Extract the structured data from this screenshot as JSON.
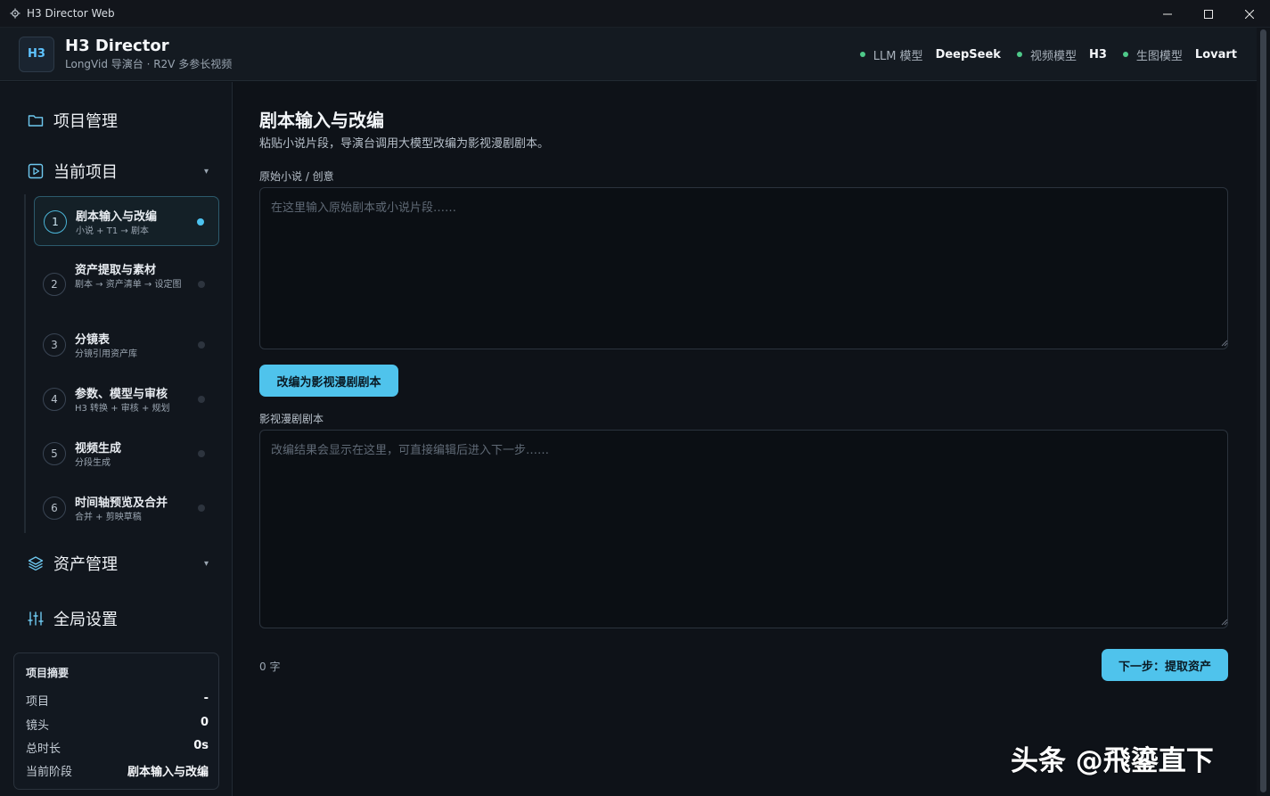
{
  "window": {
    "title": "H3 Director Web"
  },
  "header": {
    "logo": "H3",
    "title": "H3 Director",
    "subtitle": "LongVid 导演台 · R2V 多参长视频",
    "models": [
      {
        "label": "LLM 模型",
        "value": "DeepSeek"
      },
      {
        "label": "视频模型",
        "value": "H3"
      },
      {
        "label": "生图模型",
        "value": "Lovart"
      }
    ],
    "status_color": "#4ec989"
  },
  "sidebar": {
    "project_management": "项目管理",
    "current_project": "当前项目",
    "steps": [
      {
        "num": "1",
        "title": "剧本输入与改编",
        "desc": "小说 + T1 → 剧本",
        "active": true
      },
      {
        "num": "2",
        "title": "资产提取与素材",
        "desc": "剧本 → 资产清单 → 设定图",
        "active": false
      },
      {
        "num": "3",
        "title": "分镜表",
        "desc": "分镜引用资产库",
        "active": false
      },
      {
        "num": "4",
        "title": "参数、模型与审核",
        "desc": "H3 转换 + 审核 + 规划",
        "active": false
      },
      {
        "num": "5",
        "title": "视频生成",
        "desc": "分段生成",
        "active": false
      },
      {
        "num": "6",
        "title": "时间轴预览及合并",
        "desc": "合并 + 剪映草稿",
        "active": false
      }
    ],
    "asset_management": "资产管理",
    "global_settings": "全局设置",
    "summary": {
      "heading": "项目摘要",
      "rows": [
        {
          "key": "项目",
          "value": "-"
        },
        {
          "key": "镜头",
          "value": "0"
        },
        {
          "key": "总时长",
          "value": "0s"
        },
        {
          "key": "当前阶段",
          "value": "剧本输入与改编"
        }
      ]
    }
  },
  "main": {
    "title": "剧本输入与改编",
    "subtitle": "粘贴小说片段，导演台调用大模型改编为影视漫剧剧本。",
    "source_label": "原始小说 / 创意",
    "source_placeholder": "在这里输入原始剧本或小说片段……",
    "source_value": "",
    "adapt_button": "改编为影视漫剧剧本",
    "script_label": "影视漫剧剧本",
    "script_placeholder": "改编结果会显示在这里，可直接编辑后进入下一步……",
    "script_value": "",
    "char_count": "0 字",
    "next_button": "下一步：提取资产"
  },
  "accent_color": "#4fc3ec",
  "watermark": "头条 @飛鎏直下"
}
